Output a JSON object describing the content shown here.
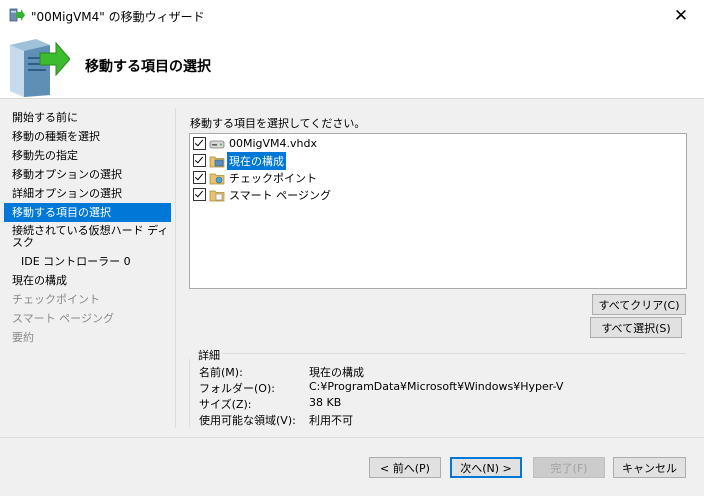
{
  "window": {
    "title": "\"00MigVM4\" の移動ウィザード",
    "close": "✕"
  },
  "header": {
    "title": "移動する項目の選択"
  },
  "nav": {
    "items": [
      {
        "label": "開始する前に"
      },
      {
        "label": "移動の種類を選択"
      },
      {
        "label": "移動先の指定"
      },
      {
        "label": "移動オプションの選択"
      },
      {
        "label": "詳細オプションの選択"
      },
      {
        "label": "移動する項目の選択"
      },
      {
        "label": "接続されている仮想ハード ディスク"
      },
      {
        "label": "IDE コントローラー 0"
      },
      {
        "label": "現在の構成"
      },
      {
        "label": "チェックポイント"
      },
      {
        "label": "スマート ページング"
      },
      {
        "label": "要約"
      }
    ]
  },
  "main": {
    "prompt": "移動する項目を選択してください。",
    "items": [
      {
        "label": "00MigVM4.vhdx",
        "icon": "disk-icon"
      },
      {
        "label": "現在の構成",
        "icon": "config-folder-icon"
      },
      {
        "label": "チェックポイント",
        "icon": "checkpoint-folder-icon"
      },
      {
        "label": "スマート ページング",
        "icon": "paging-folder-icon"
      }
    ],
    "clear_all": "すべてクリア(C)",
    "select_all": "すべて選択(S)"
  },
  "details": {
    "legend": "詳細",
    "rows": [
      {
        "label": "名前(M):",
        "value": "現在の構成"
      },
      {
        "label": "フォルダー(O):",
        "value": "C:¥ProgramData¥Microsoft¥Windows¥Hyper-V"
      },
      {
        "label": "サイズ(Z):",
        "value": "38 KB"
      },
      {
        "label": "使用可能な領域(V):",
        "value": "利用不可"
      }
    ]
  },
  "footer": {
    "back": "< 前へ(P)",
    "next": "次へ(N) >",
    "finish": "完了(F)",
    "cancel": "キャンセル"
  }
}
